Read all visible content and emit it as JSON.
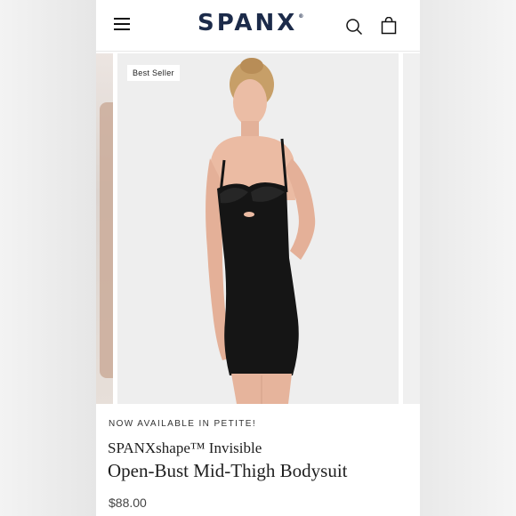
{
  "header": {
    "brand": "SPANX",
    "trademark": "®",
    "menu_icon": "hamburger-menu-icon",
    "search_icon": "search-icon",
    "cart_icon": "shopping-bag-icon"
  },
  "gallery": {
    "badge": "Best Seller"
  },
  "product": {
    "availability": "NOW AVAILABLE IN PETITE!",
    "line": "SPANXshape™ Invisible",
    "name": "Open-Bust Mid-Thigh Bodysuit",
    "price": "$88.00"
  },
  "colors": {
    "brand": "#1c2b4a",
    "garment": "#151515",
    "skin": "#e7b79f"
  }
}
